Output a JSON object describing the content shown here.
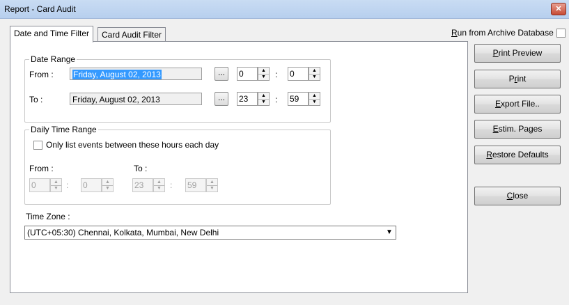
{
  "window": {
    "title": "Report  - Card Audit",
    "close_label": "✕"
  },
  "tabs": [
    {
      "label": "Date and Time Filter",
      "active": true
    },
    {
      "label": "Card Audit Filter",
      "active": false
    }
  ],
  "archive": {
    "label_first": "R",
    "label_rest": "un from Archive Database",
    "checked": false
  },
  "date_range": {
    "title": "Date Range",
    "from_label": "From :",
    "from_date": "Friday, August 02, 2013",
    "from_hour": "0",
    "from_minute": "0",
    "to_label": "To :",
    "to_date": "Friday, August 02, 2013",
    "to_hour": "23",
    "to_minute": "59",
    "browse_label": "...",
    "colon": ":"
  },
  "daily_time_range": {
    "title": "Daily Time Range",
    "checkbox_label": "Only list events between these hours each day",
    "checked": false,
    "from_label": "From :",
    "to_label": "To :",
    "from_hour": "0",
    "from_minute": "0",
    "to_hour": "23",
    "to_minute": "59",
    "colon": ":"
  },
  "time_zone": {
    "label": "Time Zone :",
    "value": "(UTC+05:30) Chennai, Kolkata, Mumbai, New Delhi"
  },
  "buttons": [
    {
      "mnemonic": "P",
      "rest": "rint Preview"
    },
    {
      "before": "P",
      "mnemonic": "r",
      "rest": "int"
    },
    {
      "mnemonic": "E",
      "rest": "xport File.."
    },
    {
      "mnemonic": "E",
      "rest": "stim. Pages"
    },
    {
      "mnemonic": "R",
      "rest": "estore Defaults"
    },
    {
      "mnemonic": "C",
      "rest": "lose"
    }
  ]
}
